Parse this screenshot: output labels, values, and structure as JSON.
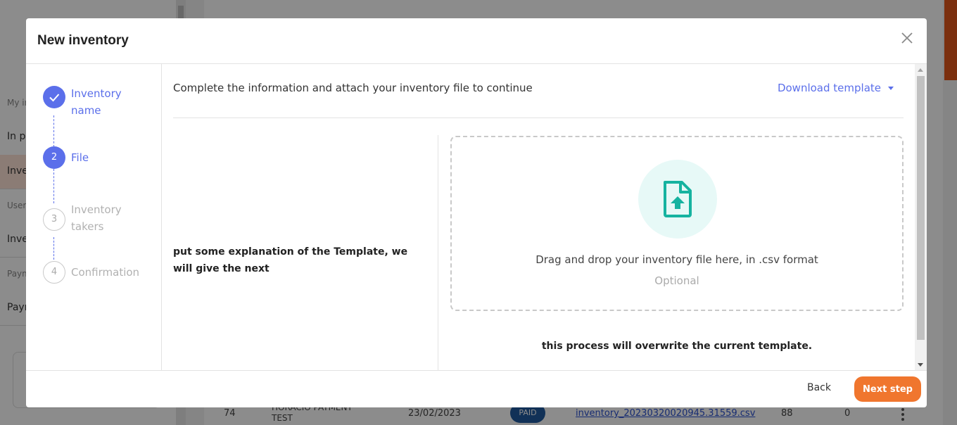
{
  "background": {
    "sidebar_items": [
      "My inventories",
      "In progress",
      "Inventories",
      "Users",
      "Inventory takers",
      "Payments",
      "Payments"
    ],
    "table_row": {
      "id": "74",
      "name_line1": "HORACIO PAYMENT",
      "name_line2": "TEST",
      "date": "23/02/2023",
      "status": "PAID",
      "file": "inventory_20230320020945.31559.csv",
      "count": "88",
      "zero": "0"
    }
  },
  "modal": {
    "title": "New inventory",
    "close_icon": "close-icon"
  },
  "steps": [
    {
      "number": "1",
      "label_line1": "Inventory",
      "label_line2": "name",
      "state": "done"
    },
    {
      "number": "2",
      "label_line1": "File",
      "label_line2": "",
      "state": "active"
    },
    {
      "number": "3",
      "label_line1": "Inventory",
      "label_line2": "takers",
      "state": "pending"
    },
    {
      "number": "4",
      "label_line1": "Confirmation",
      "label_line2": "",
      "state": "pending"
    }
  ],
  "content": {
    "info_text": "Complete the information and attach your inventory file to continue",
    "download_template": "Download template",
    "explanation": "put some explanation of the Template, we will give the next",
    "dropzone_text": "Drag and drop your inventory file here, in .csv format",
    "dropzone_optional": "Optional",
    "overwrite_notice": "this process will overwrite the current template."
  },
  "footer": {
    "back": "Back",
    "next": "Next step"
  },
  "colors": {
    "primary": "#5b6fea",
    "accent": "#f0762e",
    "upload_icon": "#16b3a0",
    "upload_bg": "#e7f9f7"
  }
}
